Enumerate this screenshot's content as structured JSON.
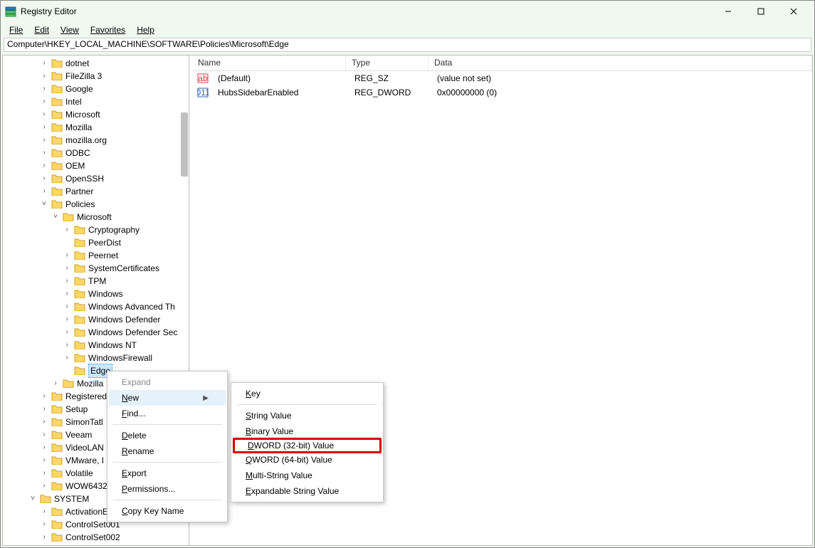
{
  "window": {
    "title": "Registry Editor"
  },
  "menu": {
    "file": "File",
    "edit": "Edit",
    "view": "View",
    "favorites": "Favorites",
    "help": "Help"
  },
  "address_path": "Computer\\HKEY_LOCAL_MACHINE\\SOFTWARE\\Policies\\Microsoft\\Edge",
  "list": {
    "headers": {
      "name": "Name",
      "type": "Type",
      "data": "Data"
    },
    "rows": [
      {
        "name": "(Default)",
        "type": "REG_SZ",
        "data": "(value not set)"
      },
      {
        "name": "HubsSidebarEnabled",
        "type": "REG_DWORD",
        "data": "0x00000000 (0)"
      }
    ]
  },
  "tree": {
    "top": [
      {
        "label": "dotnet",
        "depth": 3
      },
      {
        "label": "FileZilla 3",
        "depth": 3
      },
      {
        "label": "Google",
        "depth": 3
      },
      {
        "label": "Intel",
        "depth": 3
      },
      {
        "label": "Microsoft",
        "depth": 3
      },
      {
        "label": "Mozilla",
        "depth": 3
      },
      {
        "label": "mozilla.org",
        "depth": 3
      },
      {
        "label": "ODBC",
        "depth": 3
      },
      {
        "label": "OEM",
        "depth": 3
      },
      {
        "label": "OpenSSH",
        "depth": 3
      },
      {
        "label": "Partner",
        "depth": 3
      }
    ],
    "policies_label": "Policies",
    "microsoft_label": "Microsoft",
    "ms_children": [
      "Cryptography",
      "PeerDist",
      "Peernet",
      "SystemCertificates",
      "TPM",
      "Windows",
      "Windows Advanced Th",
      "Windows Defender",
      "Windows Defender Sec",
      "Windows NT",
      "WindowsFirewall"
    ],
    "edge_label": "Edge",
    "after_policies": [
      "Mozilla",
      "RegisteredA",
      "Setup",
      "SimonTatl",
      "Veeam",
      "VideoLAN",
      "VMware, I",
      "Volatile",
      "WOW6432"
    ],
    "system_label": "SYSTEM",
    "system_children": [
      "ActivationE",
      "ControlSet001",
      "ControlSet002"
    ]
  },
  "ctx1": {
    "expand": "Expand",
    "new": "New",
    "find": "Find...",
    "delete": "Delete",
    "rename": "Rename",
    "export": "Export",
    "permissions": "Permissions...",
    "copy": "Copy Key Name"
  },
  "ctx2": {
    "key": "Key",
    "string": "String Value",
    "binary": "Binary Value",
    "dword": "DWORD (32-bit) Value",
    "qword": "QWORD (64-bit) Value",
    "multi": "Multi-String Value",
    "expand": "Expandable String Value"
  },
  "colors": {
    "highlight_red": "#d40000"
  }
}
